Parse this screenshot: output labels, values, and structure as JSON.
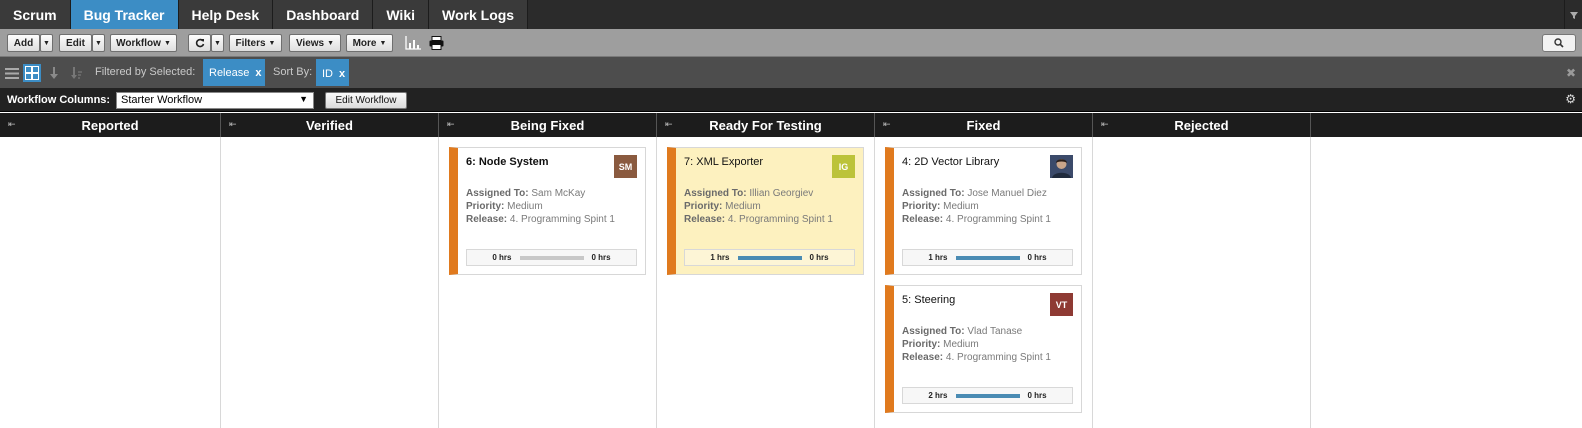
{
  "tabs": [
    {
      "label": "Scrum",
      "active": false
    },
    {
      "label": "Bug Tracker",
      "active": true
    },
    {
      "label": "Help Desk",
      "active": false
    },
    {
      "label": "Dashboard",
      "active": false
    },
    {
      "label": "Wiki",
      "active": false
    },
    {
      "label": "Work Logs",
      "active": false
    }
  ],
  "toolbar": {
    "add": "Add",
    "edit": "Edit",
    "workflow": "Workflow",
    "filters": "Filters",
    "views": "Views",
    "more": "More"
  },
  "filterbar": {
    "filtered_by": "Filtered by Selected:",
    "filter_chip": "Release",
    "sort_by": "Sort By:",
    "sort_chip": "ID",
    "chip_close": "x"
  },
  "workflow": {
    "label": "Workflow Columns:",
    "selected": "Starter Workflow",
    "edit_button": "Edit Workflow"
  },
  "columns": [
    {
      "title": "Reported"
    },
    {
      "title": "Verified"
    },
    {
      "title": "Being Fixed"
    },
    {
      "title": "Ready For Testing"
    },
    {
      "title": "Fixed"
    },
    {
      "title": "Rejected"
    }
  ],
  "field_labels": {
    "assigned": "Assigned To:",
    "priority": "Priority:",
    "release": "Release:"
  },
  "cards": [
    {
      "title": "6: Node System",
      "initials": "SM",
      "avatar_color": "#8a5a3f",
      "assigned": "Sam McKay",
      "priority": "Medium",
      "release": "4. Programming Spint 1",
      "hrs_left": "0 hrs",
      "hrs_right": "0 hrs",
      "progress": 0
    },
    {
      "title": "7: XML Exporter",
      "initials": "IG",
      "avatar_color": "#bcc33a",
      "assigned": "Illian Georgiev",
      "priority": "Medium",
      "release": "4. Programming Spint 1",
      "hrs_left": "1 hrs",
      "hrs_right": "0 hrs",
      "progress": 1
    },
    {
      "title": "4: 2D Vector Library",
      "initials": "",
      "avatar_color": "#3b4a6a",
      "assigned": "Jose Manuel Diez",
      "priority": "Medium",
      "release": "4. Programming Spint 1",
      "hrs_left": "1 hrs",
      "hrs_right": "0 hrs",
      "progress": 1
    },
    {
      "title": "5: Steering",
      "initials": "VT",
      "avatar_color": "#8e3a33",
      "assigned": "Vlad Tanase",
      "priority": "Medium",
      "release": "4. Programming Spint 1",
      "hrs_left": "2 hrs",
      "hrs_right": "0 hrs",
      "progress": 1
    }
  ],
  "colors": {
    "accent": "#3c8dc5",
    "card_stripe": "#e07a1e",
    "progress_done": "#4a8bb3",
    "progress_empty": "#c8c8c8"
  }
}
